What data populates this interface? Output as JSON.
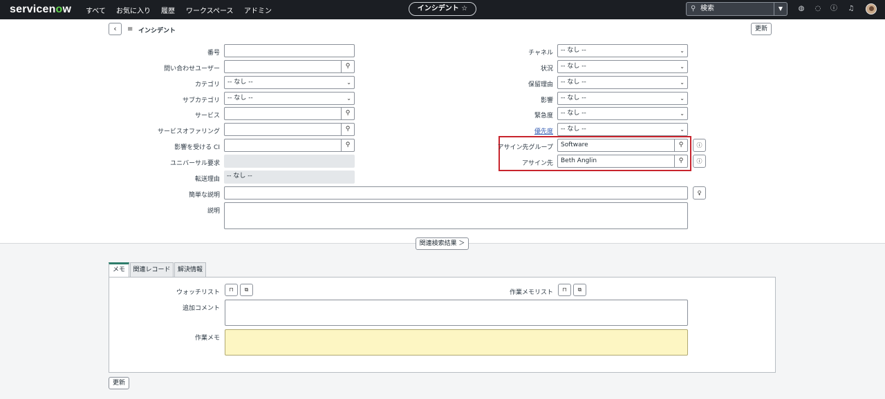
{
  "nav": {
    "brand_prefix": "servicen",
    "brand_o": "o",
    "brand_suffix": "w",
    "items": [
      "すべて",
      "お気に入り",
      "履歴",
      "ワークスペース",
      "アドミン"
    ],
    "title": "インシデント ☆",
    "search_placeholder": "検索"
  },
  "header": {
    "title": "インシデント",
    "update_label": "更新"
  },
  "form": {
    "left": {
      "number_label": "番号",
      "caller_label": "問い合わせユーザー",
      "category_label": "カテゴリ",
      "category_value": "-- なし --",
      "subcategory_label": "サブカテゴリ",
      "subcategory_value": "-- なし --",
      "service_label": "サービス",
      "service_offering_label": "サービスオファリング",
      "affected_ci_label": "影響を受ける CI",
      "universal_request_label": "ユニバーサル要求",
      "transfer_reason_label": "転送理由",
      "transfer_reason_value": "-- なし --"
    },
    "right": {
      "channel_label": "チャネル",
      "channel_value": "-- なし --",
      "state_label": "状況",
      "state_value": "-- なし --",
      "hold_reason_label": "保留理由",
      "hold_reason_value": "-- なし --",
      "impact_label": "影響",
      "impact_value": "-- なし --",
      "urgency_label": "緊急度",
      "urgency_value": "-- なし --",
      "priority_label": "優先度",
      "priority_value": "-- なし --",
      "assignment_group_label": "アサイン先グループ",
      "assignment_group_value": "Software",
      "assigned_to_label": "アサイン先",
      "assigned_to_value": "Beth Anglin"
    },
    "short_description_label": "簡単な説明",
    "description_label": "説明"
  },
  "related_search_label": "関連検索結果 ＞",
  "tabs": [
    "メモ",
    "関連レコード",
    "解決情報"
  ],
  "notes": {
    "watch_list_label": "ウォッチリスト",
    "work_notes_list_label": "作業メモリスト",
    "additional_comments_label": "追加コメント",
    "work_notes_label": "作業メモ"
  },
  "footer": {
    "update_label": "更新"
  },
  "colors": {
    "topbar": "#1b1e23",
    "brand_accent": "#62d84e",
    "highlight": "#c8232c",
    "work_notes_bg": "#fdf6c3"
  }
}
